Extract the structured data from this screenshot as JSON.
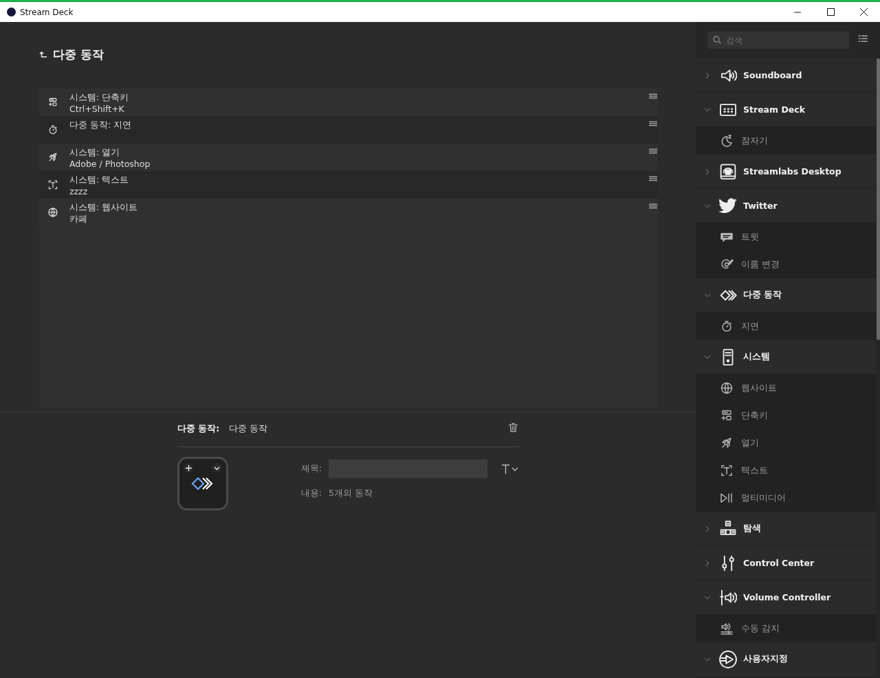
{
  "window": {
    "title": "Stream Deck"
  },
  "page": {
    "title": "다중 동작"
  },
  "actions": [
    {
      "title": "시스템: 단축키",
      "detail": "Ctrl+Shift+K"
    },
    {
      "title": "다중 동작: 지연"
    },
    {
      "title": "시스템: 열기",
      "detail": "Adobe / Photoshop"
    },
    {
      "title": "시스템: 텍스트",
      "detail": "zzzz"
    },
    {
      "title": "시스템: 웹사이트",
      "detail": "카페"
    }
  ],
  "inspector": {
    "label": "다중 동작:",
    "value": "다중 동작",
    "title_label": "제목:",
    "content_label": "내용:",
    "content_value": "5개의 동작"
  },
  "sidebar": {
    "search": {
      "placeholder": "검색"
    },
    "categories": [
      {
        "name": "Soundboard",
        "expanded": false
      },
      {
        "name": "Stream Deck",
        "expanded": true,
        "children": [
          "잠자기"
        ]
      },
      {
        "name": "Streamlabs Desktop",
        "expanded": false
      },
      {
        "name": "Twitter",
        "expanded": true,
        "children": [
          "트윗",
          "이름 변경"
        ]
      },
      {
        "name": "다중 동작",
        "expanded": true,
        "children": [
          "지연"
        ]
      },
      {
        "name": "시스템",
        "expanded": true,
        "children": [
          "웹사이트",
          "단축키",
          "열기",
          "텍스트",
          "멀티미디어"
        ]
      },
      {
        "name": "탐색",
        "expanded": false
      },
      {
        "name": "Control Center",
        "expanded": false
      },
      {
        "name": "Volume Controller",
        "expanded": true,
        "children": [
          "수동 감지"
        ]
      },
      {
        "name": "사용자지정",
        "expanded": true
      }
    ]
  }
}
